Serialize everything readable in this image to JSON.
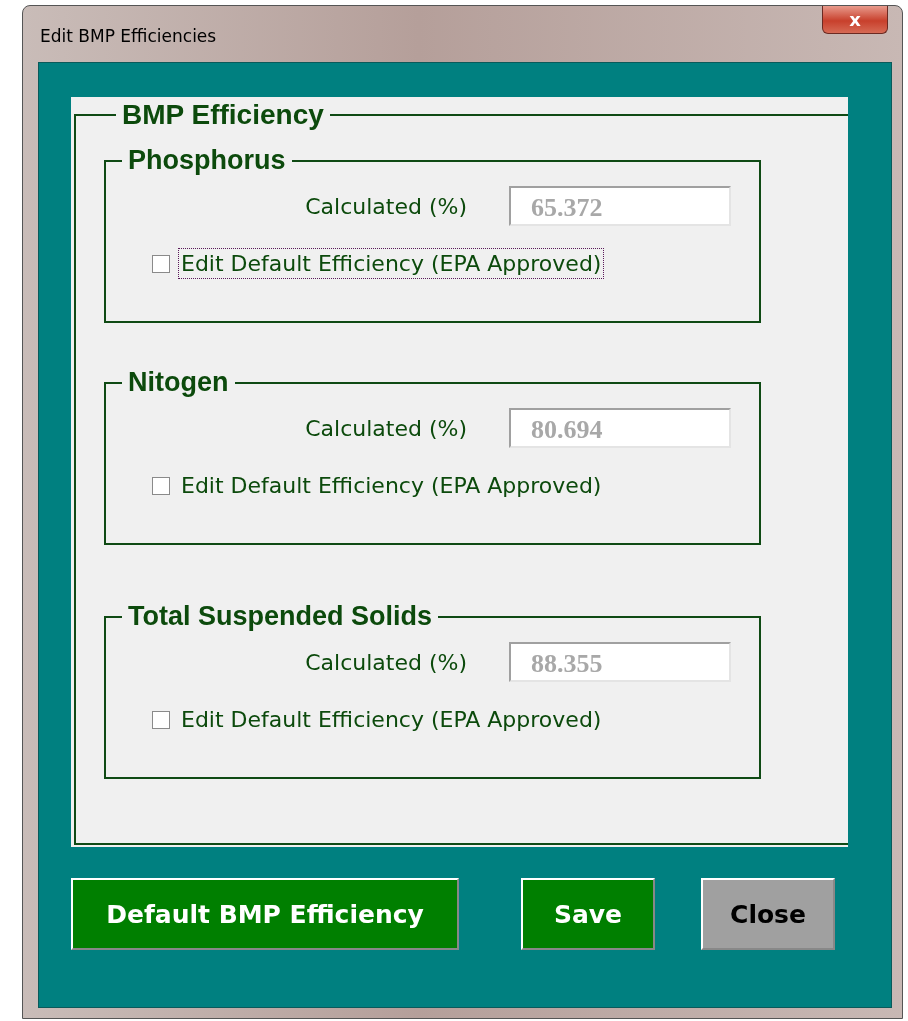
{
  "window": {
    "title": "Edit BMP Efficiencies",
    "close": "x"
  },
  "panel": {
    "title": "BMP Efficiency"
  },
  "sections": [
    {
      "title": "Phosphorus",
      "label": "Calculated (%)",
      "value": "65.372",
      "disabled": true,
      "checkbox": {
        "label": "Edit Default Efficiency (EPA Approved)",
        "checked": false,
        "focused": true
      }
    },
    {
      "title": "Nitogen",
      "label": "Calculated (%)",
      "value": "80.694",
      "disabled": true,
      "checkbox": {
        "label": "Edit Default Efficiency (EPA Approved)",
        "checked": false,
        "focused": false
      }
    },
    {
      "title": "Total Suspended Solids",
      "label": "Calculated (%)",
      "value": "88.355",
      "disabled": true,
      "checkbox": {
        "label": "Edit Default Efficiency (EPA Approved)",
        "checked": false,
        "focused": false
      }
    }
  ],
  "buttons": [
    {
      "label": "Default BMP Efficiency",
      "kind": "primary"
    },
    {
      "label": "Save",
      "kind": "primary"
    },
    {
      "label": "Close",
      "kind": "secondary"
    }
  ]
}
